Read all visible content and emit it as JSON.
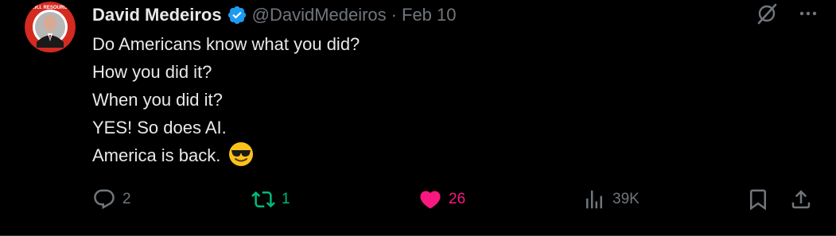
{
  "author": {
    "display_name": "David Medeiros",
    "handle": "@DavidMedeiros",
    "separator": "·",
    "date": "Feb 10",
    "avatar_badge_text": "A.R.I. RESOURCE"
  },
  "tweet": {
    "lines": [
      "Do Americans know what you did?",
      "How you did it?",
      "When you did it?",
      "YES! So does AI.",
      "America is back."
    ],
    "emoji": "smiling-face-with-sunglasses"
  },
  "actions": {
    "reply_count": "2",
    "retweet_count": "1",
    "like_count": "26",
    "views_count": "39K"
  },
  "colors": {
    "background": "#000000",
    "text": "#e7e9ea",
    "muted": "#71767b",
    "verified": "#1d9bf0",
    "retweet": "#00ba7c",
    "like": "#f91880"
  }
}
